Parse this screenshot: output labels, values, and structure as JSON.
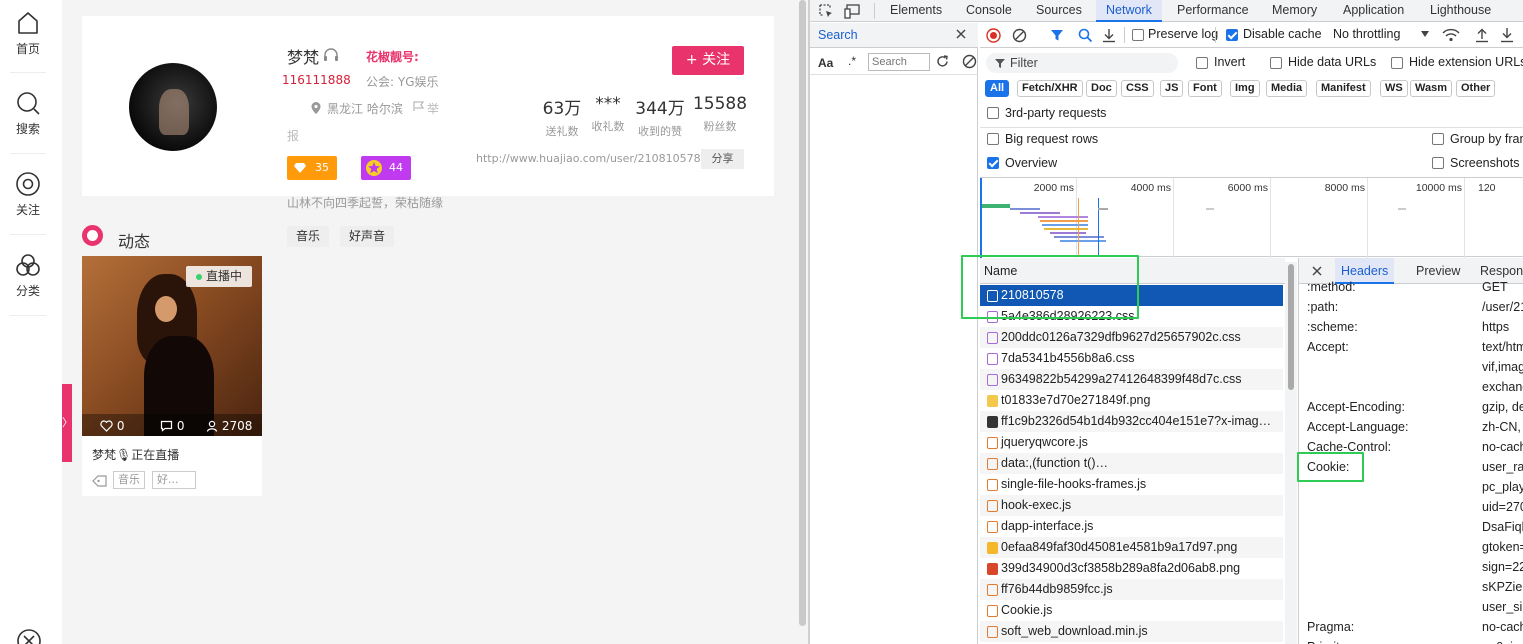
{
  "sidebar": {
    "items": [
      {
        "label": "首页",
        "icon": "home-icon"
      },
      {
        "label": "搜索",
        "icon": "search-icon"
      },
      {
        "label": "关注",
        "icon": "follow-icon"
      },
      {
        "label": "分类",
        "icon": "category-icon"
      }
    ],
    "side_tab_glyph": "〉"
  },
  "profile": {
    "nickname": "梦梵",
    "huajiao_label": "花椒靓号:",
    "user_id": "116111888",
    "guild": "公会: YG娱乐",
    "location": "黑龙江 哈尔滨",
    "report": "举",
    "report_cont": "报",
    "badge_level": "35",
    "badge_star": "44",
    "follow_label": "+ 关注",
    "stats": [
      {
        "value": "63万",
        "label": "送礼数"
      },
      {
        "value": "***",
        "label": "收礼数"
      },
      {
        "value": "344万",
        "label": "收到的赞"
      },
      {
        "value": "15588",
        "label": "粉丝数"
      }
    ],
    "url": "http://www.huajiao.com/user/210810578",
    "share_label": "分享",
    "bio": "山林不向四季起誓，荣枯随缘",
    "tags": [
      "音乐",
      "好声音"
    ]
  },
  "feed": {
    "title": "动态",
    "live": {
      "badge": "直播中",
      "likes": "0",
      "comments": "0",
      "viewers": "2708人",
      "caption": "梦梵🎙正在直播",
      "tags": [
        "音乐",
        "好..."
      ]
    }
  },
  "devtools": {
    "tabs": [
      "Elements",
      "Console",
      "Sources",
      "Network",
      "Performance",
      "Memory",
      "Application",
      "Lighthouse"
    ],
    "active_tab": "Network",
    "search": {
      "title": "Search",
      "case_label": "Aa",
      "regex_label": ".*",
      "placeholder": "Search"
    },
    "toolbar": {
      "preserve_log": "Preserve log",
      "disable_cache": "Disable cache",
      "throttling": "No throttling"
    },
    "filter": {
      "placeholder": "Filter",
      "invert": "Invert",
      "hide_data_urls": "Hide data URLs",
      "hide_extension_urls": "Hide extension URLs"
    },
    "types": [
      "All",
      "Fetch/XHR",
      "Doc",
      "CSS",
      "JS",
      "Font",
      "Img",
      "Media",
      "Manifest",
      "WS",
      "Wasm",
      "Other"
    ],
    "options": {
      "third_party": "3rd-party requests",
      "big_rows": "Big request rows",
      "group_by_frame": "Group by fran",
      "overview": "Overview",
      "screenshots": "Screenshots"
    },
    "timeline_labels": [
      "2000 ms",
      "4000 ms",
      "6000 ms",
      "8000 ms",
      "10000 ms",
      "120"
    ],
    "requests": {
      "header": "Name",
      "rows": [
        {
          "name": "210810578",
          "kind": "doc"
        },
        {
          "name": "5a4e386d28926223.css",
          "kind": "css"
        },
        {
          "name": "200ddc0126a7329dfb9627d25657902c.css",
          "kind": "css"
        },
        {
          "name": "7da5341b4556b8a6.css",
          "kind": "css"
        },
        {
          "name": "96349822b54299a27412648399f48d7c.css",
          "kind": "css"
        },
        {
          "name": "t01833e7d70e271849f.png",
          "kind": "img"
        },
        {
          "name": "ff1c9b2326d54b1d4b932cc404e151e7?x-imag…",
          "kind": "img-dark"
        },
        {
          "name": "jqueryqwcore.js",
          "kind": "js"
        },
        {
          "name": "data:,(function t()…",
          "kind": "js"
        },
        {
          "name": "single-file-hooks-frames.js",
          "kind": "js"
        },
        {
          "name": "hook-exec.js",
          "kind": "js"
        },
        {
          "name": "dapp-interface.js",
          "kind": "js"
        },
        {
          "name": "0efaa849faf30d45081e4581b9a17d97.png",
          "kind": "img-gold"
        },
        {
          "name": "399d34900d3cf3858b289a8fa2d06ab8.png",
          "kind": "img-red"
        },
        {
          "name": "ff76b44db9859fcc.js",
          "kind": "js"
        },
        {
          "name": "Cookie.js",
          "kind": "js"
        },
        {
          "name": "soft_web_download.min.js",
          "kind": "js"
        }
      ]
    },
    "detail": {
      "tabs": [
        "Headers",
        "Preview",
        "Response"
      ],
      "active_tab": "Headers",
      "headers": [
        {
          "k": ":method:",
          "v": "GET"
        },
        {
          "k": ":path:",
          "v": "/user/21"
        },
        {
          "k": ":scheme:",
          "v": "https"
        },
        {
          "k": "Accept:",
          "v": "text/htm"
        },
        {
          "k": "",
          "v": "vif,imag"
        },
        {
          "k": "",
          "v": "exchang"
        },
        {
          "k": "Accept-Encoding:",
          "v": "gzip, de"
        },
        {
          "k": "Accept-Language:",
          "v": "zh-CN,"
        },
        {
          "k": "Cache-Control:",
          "v": "no-cach"
        },
        {
          "k": "Cookie:",
          "v": "user_ra"
        },
        {
          "k": "",
          "v": "pc_play"
        },
        {
          "k": "",
          "v": "uid=270"
        },
        {
          "k": "",
          "v": "DsaFiql"
        },
        {
          "k": "",
          "v": "gtoken="
        },
        {
          "k": "",
          "v": "sign=22"
        },
        {
          "k": "",
          "v": "sKPZiel"
        },
        {
          "k": "",
          "v": "user_si"
        },
        {
          "k": "Pragma:",
          "v": "no-cach"
        },
        {
          "k": "Priority:",
          "v": "u=0, i"
        }
      ]
    }
  },
  "colors": {
    "brand_pink": "#e8336c",
    "devtools_blue": "#1a73e8",
    "selected_row": "#1058b3",
    "highlight_green": "#2ecc55"
  }
}
